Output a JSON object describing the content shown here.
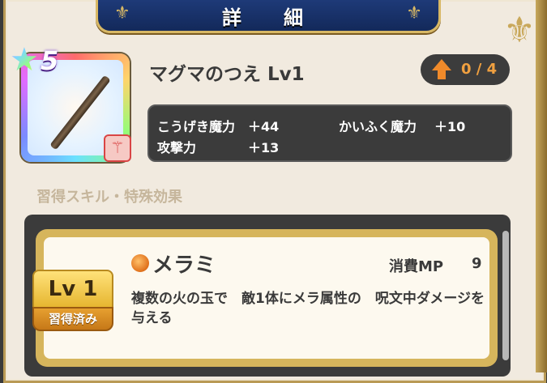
{
  "header": {
    "title": "詳　細"
  },
  "item": {
    "rarity": "5",
    "name": "マグマのつえ Lv1",
    "type_icon": "wand-icon",
    "upgrade": "0 / 4"
  },
  "stats": {
    "attack_magic_label": "こうげき魔力",
    "attack_magic_value": "＋44",
    "heal_magic_label": "かいふく魔力",
    "heal_magic_value": "＋10",
    "attack_label": "攻撃力",
    "attack_value": "＋13"
  },
  "section": {
    "title": "習得スキル・特殊効果"
  },
  "skill": {
    "level": "Lv 1",
    "status": "習得済み",
    "name": "メラミ",
    "mp_label": "消費MP",
    "mp_value": "9",
    "description": "複数の火の玉で　敵1体にメラ属性の　呪文中ダメージを与える"
  },
  "colors": {
    "banner": "#1e3a78",
    "gold": "#d8b865",
    "parchment": "#f1eadf",
    "dark_panel": "#3b3b3b",
    "upgrade_orange": "#f08a2a"
  }
}
